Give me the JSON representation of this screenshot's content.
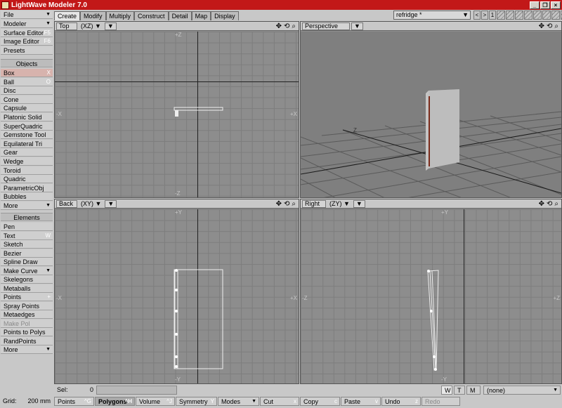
{
  "window": {
    "title": "LightWave Modeler 7.0",
    "min": "_",
    "restore": "❐",
    "close": "×"
  },
  "tabs": [
    "Create",
    "Modify",
    "Multiply",
    "Construct",
    "Detail",
    "Map",
    "Display"
  ],
  "object_select": "refridge *",
  "layers": {
    "prev": "<",
    "next": ">",
    "current": "1"
  },
  "sidebar": {
    "file": "File",
    "modeler": "Modeler",
    "surface_editor": "Surface Editor",
    "surface_editor_key": "F5",
    "image_editor": "Image Editor",
    "image_editor_key": "F6",
    "presets": "Presets",
    "objects_header": "Objects",
    "objects": [
      {
        "label": "Box",
        "key": "X"
      },
      {
        "label": "Ball",
        "key": "O"
      },
      {
        "label": "Disc",
        "key": ""
      },
      {
        "label": "Cone",
        "key": ""
      },
      {
        "label": "Capsule",
        "key": ""
      },
      {
        "label": "Platonic Solid",
        "key": ""
      },
      {
        "label": "SuperQuadric",
        "key": ""
      },
      {
        "label": "Gemstone Tool",
        "key": ""
      },
      {
        "label": "Equilateral Tri",
        "key": ""
      },
      {
        "label": "Gear",
        "key": ""
      },
      {
        "label": "Wedge",
        "key": ""
      },
      {
        "label": "Toroid",
        "key": ""
      },
      {
        "label": "Quadric",
        "key": ""
      },
      {
        "label": "ParametricObj",
        "key": ""
      },
      {
        "label": "Bubbles",
        "key": ""
      },
      {
        "label": "More",
        "key": ""
      }
    ],
    "elements_header": "Elements",
    "elements": [
      {
        "label": "Pen",
        "key": ""
      },
      {
        "label": "Text",
        "key": "W"
      },
      {
        "label": "Sketch",
        "key": ""
      },
      {
        "label": "Bezier",
        "key": ""
      },
      {
        "label": "Spline Draw",
        "key": ""
      },
      {
        "label": "Make Curve",
        "key": ""
      },
      {
        "label": "Skelegons",
        "key": ""
      },
      {
        "label": "Metaballs",
        "key": ""
      },
      {
        "label": "Points",
        "key": "+"
      },
      {
        "label": "Spray Points",
        "key": ""
      },
      {
        "label": "Metaedges",
        "key": ""
      },
      {
        "label": "Make Pol",
        "key": ""
      },
      {
        "label": "Points to Polys",
        "key": ""
      },
      {
        "label": "RandPoints",
        "key": ""
      },
      {
        "label": "More",
        "key": ""
      }
    ]
  },
  "viewports": {
    "top": {
      "name": "Top",
      "axes": "(XZ)",
      "labels": {
        "up": "+Z",
        "down": "-Z",
        "left": "-X",
        "right": "+X"
      }
    },
    "persp": {
      "name": "Perspective",
      "axis_label": "Z"
    },
    "back": {
      "name": "Back",
      "axes": "(XY)",
      "labels": {
        "up": "+Y",
        "down": "-Y",
        "left": "-X",
        "right": "+X"
      }
    },
    "right": {
      "name": "Right",
      "axes": "(ZY)",
      "labels": {
        "up": "+Y",
        "down": "-Y",
        "left": "-Z",
        "right": "+Z"
      }
    }
  },
  "status": {
    "sel_label": "Sel:",
    "sel_value": "0",
    "grid_label": "Grid:",
    "grid_value": "200 mm",
    "w": "W",
    "t": "T",
    "m": "M",
    "surface": "(none)"
  },
  "bottom_buttons": [
    {
      "label": "Points",
      "key": "^G"
    },
    {
      "label": "Polygons",
      "key": "^H"
    },
    {
      "label": "Volume",
      "key": "^J"
    },
    {
      "label": "Symmetry",
      "key": "Y"
    },
    {
      "label": "Modes",
      "key": ""
    },
    {
      "label": "Cut",
      "key": "x"
    },
    {
      "label": "Copy",
      "key": "c"
    },
    {
      "label": "Paste",
      "key": "v"
    },
    {
      "label": "Undo",
      "key": "z"
    },
    {
      "label": "Redo",
      "key": ""
    }
  ]
}
